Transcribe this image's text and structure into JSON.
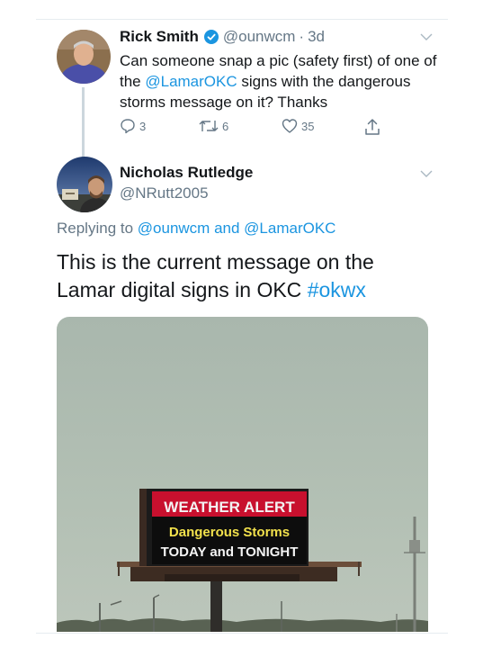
{
  "colors": {
    "accent": "#1b95e0",
    "secondary_text": "#657786",
    "primary_text": "#14171a",
    "sign_red": "#c8102e",
    "sign_yellow": "#f2e14c"
  },
  "tweet1": {
    "name": "Rick Smith",
    "handle": "@ounwcm",
    "separator": "·",
    "time": "3d",
    "text_before": "Can someone snap a pic (safety first) of one of the ",
    "mention": "@LamarOKC",
    "text_after": " signs with the dangerous storms message on it? Thanks",
    "replies": "3",
    "retweets": "6",
    "likes": "35",
    "icons": [
      "reply-icon",
      "retweet-icon",
      "like-icon",
      "share-icon",
      "verified-icon",
      "chevron-down-icon"
    ]
  },
  "tweet2": {
    "name": "Nicholas Rutledge",
    "handle": "@NRutt2005",
    "replying_prefix": "Replying to ",
    "replying_user1": "@ounwcm",
    "replying_and": " and ",
    "replying_user2": "@LamarOKC",
    "text_before": "This is the current message on the Lamar digital signs in OKC ",
    "hashtag": "#okwx",
    "sign": {
      "line1": "WEATHER ALERT",
      "line2": "Dangerous Storms",
      "line3": "TODAY and TONIGHT"
    }
  }
}
